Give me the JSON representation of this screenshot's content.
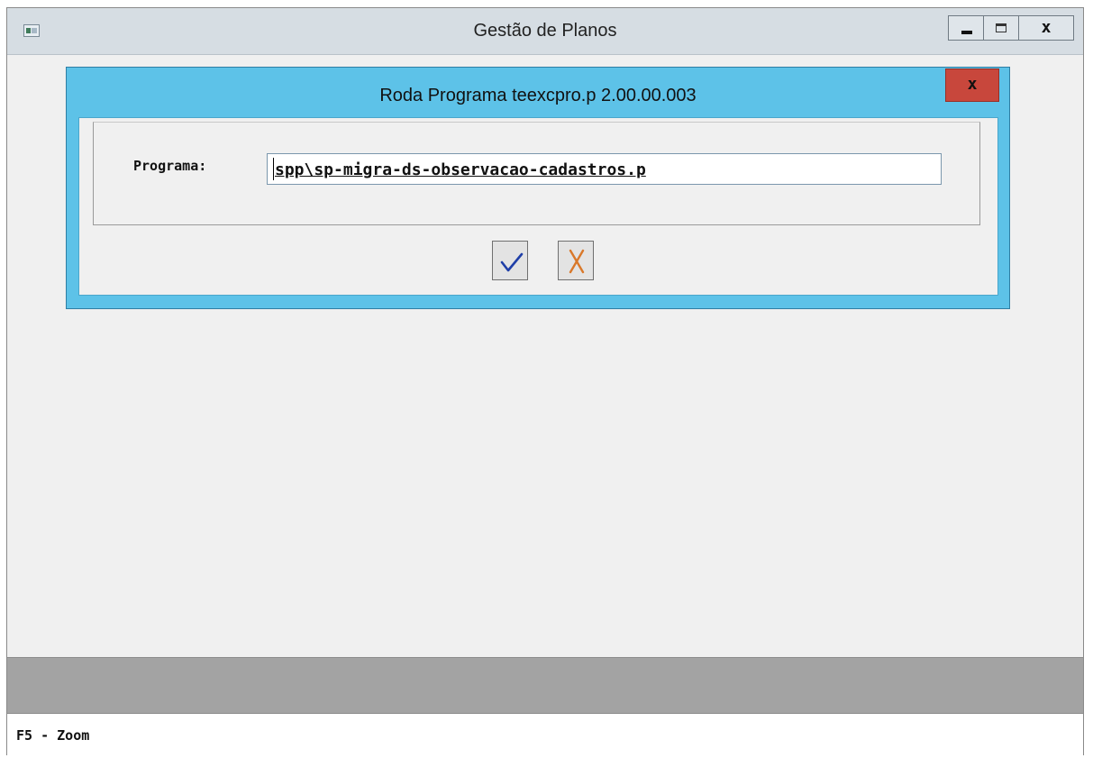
{
  "main_window": {
    "title": "Gestão de Planos",
    "controls": {
      "minimize": "minimize",
      "maximize": "maximize",
      "close": "x"
    }
  },
  "dialog": {
    "title": "Roda Programa teexcpro.p  2.00.00.003",
    "close_label": "x",
    "field": {
      "label": "Programa:",
      "value": "spp\\sp-migra-ds-observacao-cadastros.p"
    },
    "buttons": {
      "ok_icon": "checkmark-icon",
      "cancel_icon": "x-cancel-icon"
    }
  },
  "status_bar": {
    "text": "F5 - Zoom"
  },
  "colors": {
    "dialog_frame": "#5dc2e8",
    "dialog_close": "#c8473c",
    "ok_check": "#1f3fa8",
    "cancel_x": "#d9782a"
  }
}
